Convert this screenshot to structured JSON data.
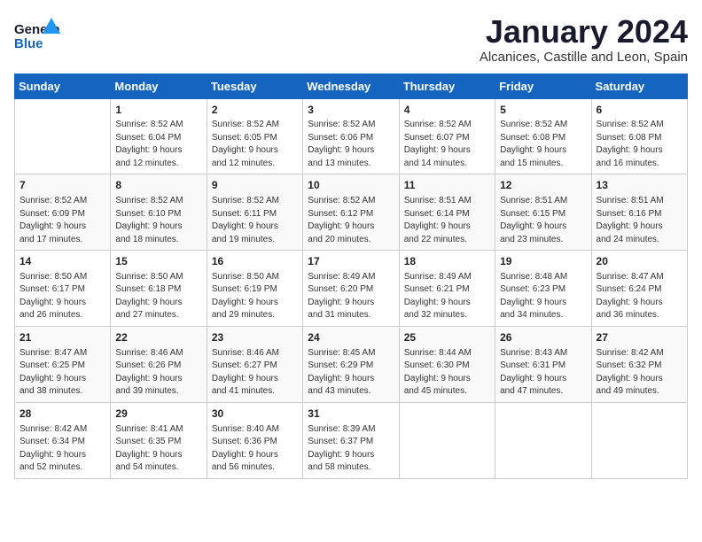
{
  "header": {
    "logo_text_general": "General",
    "logo_text_blue": "Blue",
    "month_title": "January 2024",
    "subtitle": "Alcanices, Castille and Leon, Spain"
  },
  "calendar": {
    "days_of_week": [
      "Sunday",
      "Monday",
      "Tuesday",
      "Wednesday",
      "Thursday",
      "Friday",
      "Saturday"
    ],
    "weeks": [
      [
        {
          "day": "",
          "info": ""
        },
        {
          "day": "1",
          "info": "Sunrise: 8:52 AM\nSunset: 6:04 PM\nDaylight: 9 hours\nand 12 minutes."
        },
        {
          "day": "2",
          "info": "Sunrise: 8:52 AM\nSunset: 6:05 PM\nDaylight: 9 hours\nand 12 minutes."
        },
        {
          "day": "3",
          "info": "Sunrise: 8:52 AM\nSunset: 6:06 PM\nDaylight: 9 hours\nand 13 minutes."
        },
        {
          "day": "4",
          "info": "Sunrise: 8:52 AM\nSunset: 6:07 PM\nDaylight: 9 hours\nand 14 minutes."
        },
        {
          "day": "5",
          "info": "Sunrise: 8:52 AM\nSunset: 6:08 PM\nDaylight: 9 hours\nand 15 minutes."
        },
        {
          "day": "6",
          "info": "Sunrise: 8:52 AM\nSunset: 6:08 PM\nDaylight: 9 hours\nand 16 minutes."
        }
      ],
      [
        {
          "day": "7",
          "info": "Sunrise: 8:52 AM\nSunset: 6:09 PM\nDaylight: 9 hours\nand 17 minutes."
        },
        {
          "day": "8",
          "info": "Sunrise: 8:52 AM\nSunset: 6:10 PM\nDaylight: 9 hours\nand 18 minutes."
        },
        {
          "day": "9",
          "info": "Sunrise: 8:52 AM\nSunset: 6:11 PM\nDaylight: 9 hours\nand 19 minutes."
        },
        {
          "day": "10",
          "info": "Sunrise: 8:52 AM\nSunset: 6:12 PM\nDaylight: 9 hours\nand 20 minutes."
        },
        {
          "day": "11",
          "info": "Sunrise: 8:51 AM\nSunset: 6:14 PM\nDaylight: 9 hours\nand 22 minutes."
        },
        {
          "day": "12",
          "info": "Sunrise: 8:51 AM\nSunset: 6:15 PM\nDaylight: 9 hours\nand 23 minutes."
        },
        {
          "day": "13",
          "info": "Sunrise: 8:51 AM\nSunset: 6:16 PM\nDaylight: 9 hours\nand 24 minutes."
        }
      ],
      [
        {
          "day": "14",
          "info": "Sunrise: 8:50 AM\nSunset: 6:17 PM\nDaylight: 9 hours\nand 26 minutes."
        },
        {
          "day": "15",
          "info": "Sunrise: 8:50 AM\nSunset: 6:18 PM\nDaylight: 9 hours\nand 27 minutes."
        },
        {
          "day": "16",
          "info": "Sunrise: 8:50 AM\nSunset: 6:19 PM\nDaylight: 9 hours\nand 29 minutes."
        },
        {
          "day": "17",
          "info": "Sunrise: 8:49 AM\nSunset: 6:20 PM\nDaylight: 9 hours\nand 31 minutes."
        },
        {
          "day": "18",
          "info": "Sunrise: 8:49 AM\nSunset: 6:21 PM\nDaylight: 9 hours\nand 32 minutes."
        },
        {
          "day": "19",
          "info": "Sunrise: 8:48 AM\nSunset: 6:23 PM\nDaylight: 9 hours\nand 34 minutes."
        },
        {
          "day": "20",
          "info": "Sunrise: 8:47 AM\nSunset: 6:24 PM\nDaylight: 9 hours\nand 36 minutes."
        }
      ],
      [
        {
          "day": "21",
          "info": "Sunrise: 8:47 AM\nSunset: 6:25 PM\nDaylight: 9 hours\nand 38 minutes."
        },
        {
          "day": "22",
          "info": "Sunrise: 8:46 AM\nSunset: 6:26 PM\nDaylight: 9 hours\nand 39 minutes."
        },
        {
          "day": "23",
          "info": "Sunrise: 8:46 AM\nSunset: 6:27 PM\nDaylight: 9 hours\nand 41 minutes."
        },
        {
          "day": "24",
          "info": "Sunrise: 8:45 AM\nSunset: 6:29 PM\nDaylight: 9 hours\nand 43 minutes."
        },
        {
          "day": "25",
          "info": "Sunrise: 8:44 AM\nSunset: 6:30 PM\nDaylight: 9 hours\nand 45 minutes."
        },
        {
          "day": "26",
          "info": "Sunrise: 8:43 AM\nSunset: 6:31 PM\nDaylight: 9 hours\nand 47 minutes."
        },
        {
          "day": "27",
          "info": "Sunrise: 8:42 AM\nSunset: 6:32 PM\nDaylight: 9 hours\nand 49 minutes."
        }
      ],
      [
        {
          "day": "28",
          "info": "Sunrise: 8:42 AM\nSunset: 6:34 PM\nDaylight: 9 hours\nand 52 minutes."
        },
        {
          "day": "29",
          "info": "Sunrise: 8:41 AM\nSunset: 6:35 PM\nDaylight: 9 hours\nand 54 minutes."
        },
        {
          "day": "30",
          "info": "Sunrise: 8:40 AM\nSunset: 6:36 PM\nDaylight: 9 hours\nand 56 minutes."
        },
        {
          "day": "31",
          "info": "Sunrise: 8:39 AM\nSunset: 6:37 PM\nDaylight: 9 hours\nand 58 minutes."
        },
        {
          "day": "",
          "info": ""
        },
        {
          "day": "",
          "info": ""
        },
        {
          "day": "",
          "info": ""
        }
      ]
    ]
  }
}
